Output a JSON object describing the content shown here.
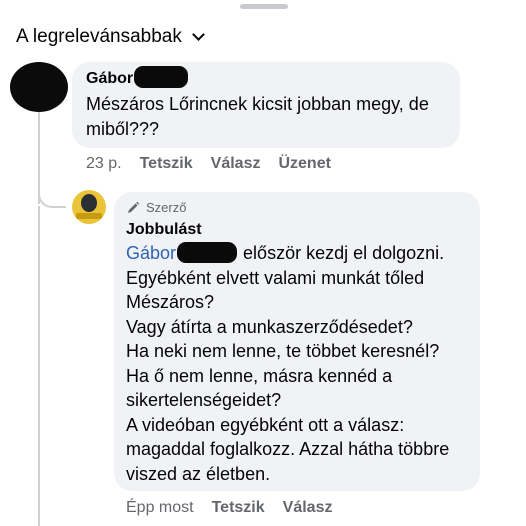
{
  "sort": {
    "label": "A legrelevánsabbak",
    "icon": "chevron-down-icon"
  },
  "comment": {
    "author": "Gábor",
    "text": "Mészáros Lőrincnek kicsit jobban megy, de miből???",
    "time": "23 p.",
    "actions": [
      "Tetszik",
      "Válasz",
      "Üzenet"
    ]
  },
  "reply": {
    "badge": "Szerző",
    "author": "Jobbulást",
    "mention": "Gábor",
    "text_after_mention": "először kezdj el dolgozni.",
    "text_body": "Egyébként elvett valami munkát tőled Mészáros?\nVagy átírta a munkaszerződésedet?\nHa neki nem lenne, te többet keresnél?\nHa ő nem lenne, másra kennéd a sikertelenségeidet?\nA videóban egyébként ott a válasz: magaddal foglalkozz. Azzal hátha többre viszed az életben.",
    "time": "Épp most",
    "actions": [
      "Tetszik",
      "Válasz"
    ]
  },
  "colors": {
    "bubble": "#f0f2f5",
    "mention": "#2f63b5",
    "meta": "#65676b",
    "avatar_brand": "#e9c338"
  }
}
